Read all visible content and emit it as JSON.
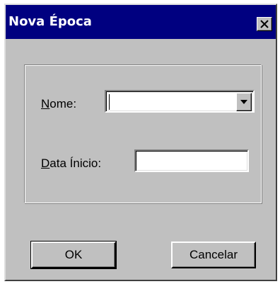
{
  "dialog": {
    "title": "Nova Época",
    "close_icon": "close-icon"
  },
  "form": {
    "nome_label_accel": "N",
    "nome_label_rest": "ome:",
    "nome_value": "",
    "data_inicio_label_accel": "D",
    "data_inicio_label_rest": "ata Ínicio:",
    "data_inicio_value": ""
  },
  "buttons": {
    "ok_label": "OK",
    "cancel_label": "Cancelar"
  }
}
